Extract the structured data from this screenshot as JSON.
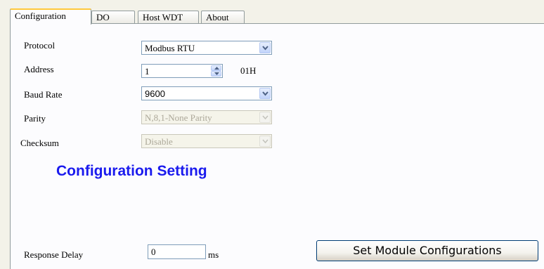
{
  "tabs": [
    {
      "label": "Configuration",
      "active": true
    },
    {
      "label": "DO",
      "active": false
    },
    {
      "label": "Host WDT",
      "active": false
    },
    {
      "label": "About",
      "active": false
    }
  ],
  "config": {
    "protocol": {
      "label": "Protocol",
      "value": "Modbus RTU"
    },
    "address": {
      "label": "Address",
      "value": "1",
      "hex": "01H"
    },
    "baud": {
      "label": "Baud Rate",
      "value": "9600"
    },
    "parity": {
      "label": "Parity",
      "value": "N,8,1-None Parity",
      "enabled": false
    },
    "checksum": {
      "label": "Checksum",
      "value": "Disable",
      "enabled": false
    }
  },
  "heading": "Configuration Setting",
  "response_delay": {
    "label": "Response Delay",
    "value": "0",
    "unit": "ms"
  },
  "set_button": "Set Module Configurations",
  "colors": {
    "heading": "#1a1aee",
    "active_tab_accent": "#ffc83c",
    "field_border": "#7f9db9"
  }
}
